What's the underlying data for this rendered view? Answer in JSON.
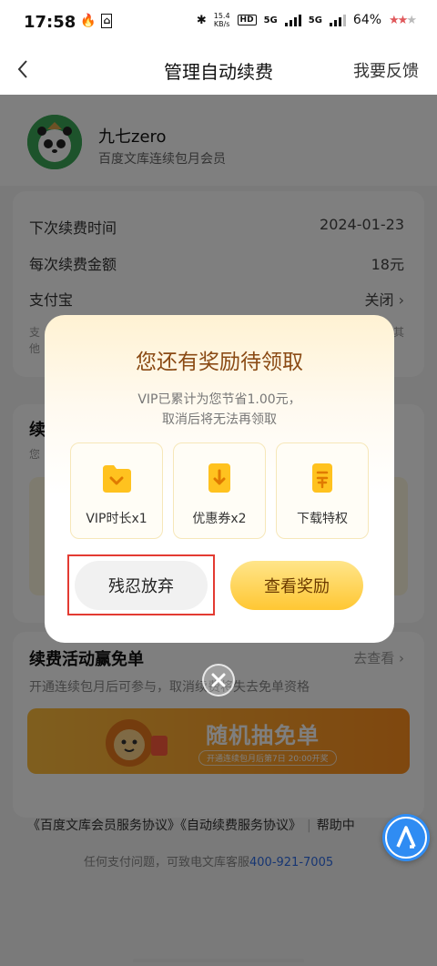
{
  "status_bar": {
    "time": "17:58",
    "net_speed_value": "15.4",
    "net_speed_unit": "KB/s",
    "hd": "HD",
    "network_1": "5G",
    "network_2": "5G",
    "battery": "64%"
  },
  "nav": {
    "title": "管理自动续费",
    "feedback": "我要反馈"
  },
  "profile": {
    "name": "九七zero",
    "membership": "百度文库连续包月会员"
  },
  "renewal_info": {
    "rows": [
      {
        "label": "下次续费时间",
        "value": "2024-01-23"
      },
      {
        "label": "每次续费金额",
        "value": "18元"
      },
      {
        "label": "支付宝",
        "value": "关闭"
      }
    ],
    "note_left": "支",
    "note_right": "其",
    "note_line2": "他"
  },
  "card2": {
    "title_fragment": "续",
    "sub_fragment": "您"
  },
  "activity": {
    "title": "续费活动赢免单",
    "link": "去查看",
    "desc": "开通连续包月后可参与，取消续费将失去免单资格",
    "banner_title": "随机抽免单",
    "banner_sub": "开通连续包月后第7日 20:00开奖"
  },
  "footer": {
    "agreement_1": "《百度文库会员服务协议》",
    "agreement_2": "《自动续费服务协议》",
    "help": "帮助中",
    "support_text": "任何支付问题，可致电文库客服",
    "support_phone": "400-921-7005"
  },
  "modal": {
    "title": "您还有奖励待领取",
    "desc_line1": "VIP已累计为您节省1.00元，",
    "desc_line2": "取消后将无法再领取",
    "perks": [
      {
        "label": "VIP时长x1",
        "icon": "vip-folder-icon"
      },
      {
        "label": "优惠券x2",
        "icon": "coupon-icon"
      },
      {
        "label": "下载特权",
        "icon": "download-privilege-icon"
      }
    ],
    "abandon_label": "残忍放弃",
    "view_label": "查看奖励"
  },
  "colors": {
    "modal_title": "#8a4a14",
    "highlight": "#e33b32",
    "phone_link": "#2e6de6",
    "primary_button": "#ffc733",
    "perk_icon": "#ffc21f"
  }
}
